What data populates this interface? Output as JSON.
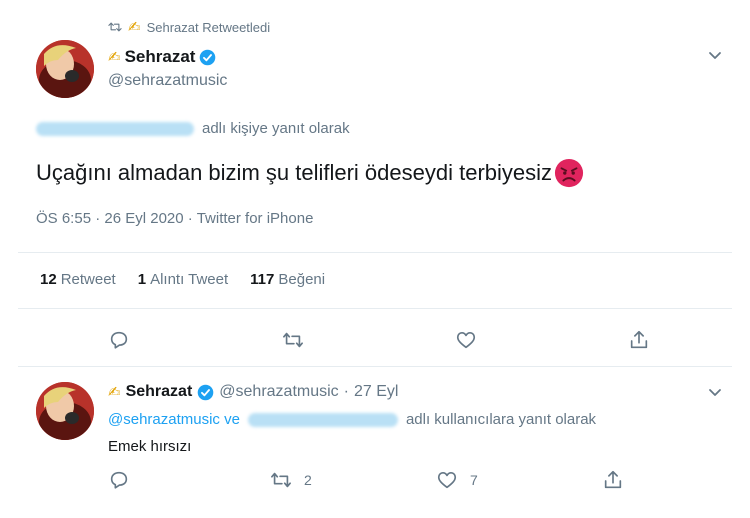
{
  "retweet_header": {
    "text": "Sehrazat Retweetledi"
  },
  "main_tweet": {
    "display_name": "Sehrazat",
    "handle": "@sehrazatmusic",
    "reply_suffix": "adlı kişiye yanıt olarak",
    "text": "Uçağını almadan bizim şu telifleri ödeseydi terbiyesiz",
    "emoji": "angry-face-emoji",
    "time": "ÖS 6:55",
    "date": "26 Eyl 2020",
    "source": "Twitter for iPhone",
    "meta_separator": "·",
    "stats": {
      "retweet_count": "12",
      "retweet_label": "Retweet",
      "quote_count": "1",
      "quote_label": "Alıntı Tweet",
      "like_count": "117",
      "like_label": "Beğeni"
    }
  },
  "reply_tweet": {
    "display_name": "Sehrazat",
    "handle": "@sehrazatmusic",
    "separator": "·",
    "date": "27 Eyl",
    "reply_mention": "@sehrazatmusic ve",
    "reply_suffix": "adlı kullanıcılara yanıt olarak",
    "text": "Emek hırsızı",
    "retweet_count": "2",
    "like_count": "7"
  },
  "colors": {
    "accent": "#1da1f2",
    "secondary_text": "#657786",
    "primary_text": "#14171a",
    "verified": "#1da1f2",
    "angry_emoji": "#e0245e"
  },
  "icons": [
    "retweet-icon",
    "pen-icon",
    "verified-badge-icon",
    "chevron-down-icon",
    "reply-icon",
    "like-icon",
    "share-icon",
    "angry-face-emoji"
  ]
}
